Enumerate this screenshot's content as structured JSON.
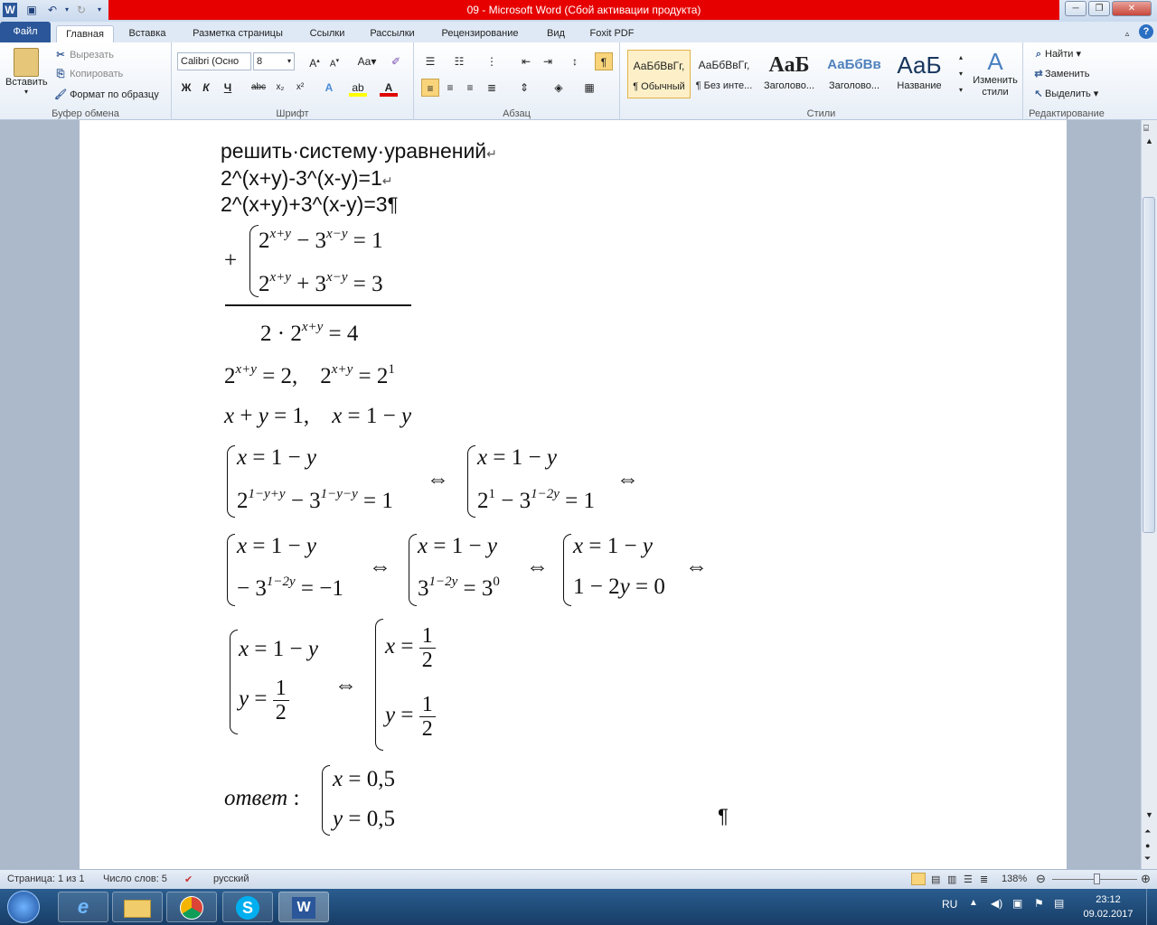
{
  "window": {
    "title": "09  -  Microsoft Word (Сбой активации продукта)"
  },
  "tabs": [
    "Файл",
    "Главная",
    "Вставка",
    "Разметка страницы",
    "Ссылки",
    "Рассылки",
    "Рецензирование",
    "Вид",
    "Foxit PDF"
  ],
  "clipboard": {
    "paste": "Вставить",
    "cut": "Вырезать",
    "copy": "Копировать",
    "format_painter": "Формат по образцу",
    "label": "Буфер обмена"
  },
  "font": {
    "name": "Calibri (Осно",
    "size": "8",
    "label": "Шрифт"
  },
  "paragraph": {
    "label": "Абзац"
  },
  "styles": {
    "items": [
      {
        "preview": "АаБбВвГг,",
        "name": "¶ Обычный"
      },
      {
        "preview": "АаБбВвГг,",
        "name": "¶ Без инте..."
      },
      {
        "preview": "АаБ",
        "name": "Заголово..."
      },
      {
        "preview": "АаБбВв",
        "name": "Заголово..."
      },
      {
        "preview": "АаБ",
        "name": "Название"
      }
    ],
    "change": "Изменить стили",
    "label": "Стили"
  },
  "editing": {
    "find": "Найти",
    "replace": "Заменить",
    "select": "Выделить",
    "label": "Редактирование"
  },
  "document": {
    "l1": "решить·систему·уравнений",
    "l2": "2^(x+y)-3^(x-y)=1",
    "l3": "2^(x+y)+3^(x-y)=3",
    "answer_word": "ответ"
  },
  "status": {
    "page": "Страница: 1 из 1",
    "words": "Число слов: 5",
    "lang": "русский",
    "zoom": "138%"
  },
  "tray": {
    "lang": "RU",
    "time": "23:12",
    "date": "09.02.2017"
  }
}
